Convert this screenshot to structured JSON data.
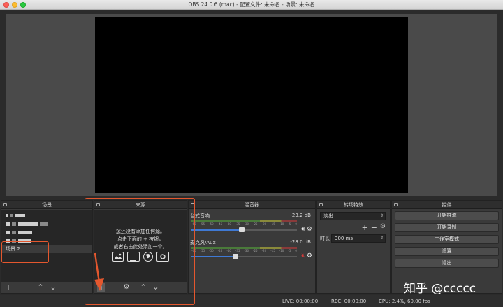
{
  "window": {
    "title": "OBS 24.0.6 (mac) - 配置文件: 未命名 - 场景: 未命名"
  },
  "docks": {
    "scenes": {
      "title": "场景",
      "selected": "场景 2"
    },
    "sources": {
      "title": "来源",
      "empty_line1": "您还没有添加任何源。",
      "empty_line2": "点击下面的 + 按钮，",
      "empty_line3": "或者右击此处添加一个。"
    },
    "mixer": {
      "title": "混音器",
      "tracks": [
        {
          "name": "台式音响",
          "db": "-23.2 dB",
          "level": 0.48,
          "muted": false
        },
        {
          "name": "麦克风/Aux",
          "db": "-28.0 dB",
          "level": 0.42,
          "muted": true
        }
      ],
      "ticks": [
        "-60",
        "-55",
        "-50",
        "-45",
        "-40",
        "-35",
        "-30",
        "-25",
        "-20",
        "-15",
        "-10",
        "-5",
        "0"
      ]
    },
    "transitions": {
      "title": "转场特效",
      "transition": "淡出",
      "duration_label": "时长",
      "duration": "300 ms"
    },
    "controls": {
      "title": "控件",
      "buttons": [
        "开始推流",
        "开始录制",
        "工作室模式",
        "设置",
        "退出"
      ]
    }
  },
  "status": {
    "live": "LIVE: 00:00:00",
    "rec": "REC: 00:00:00",
    "cpu": "CPU: 2.4%, 60.00 fps"
  },
  "watermark": "知乎 @ccccc",
  "colors": {
    "accent": "#3f79d4",
    "annotation": "#e4572e",
    "muted": "#d33a3a"
  }
}
